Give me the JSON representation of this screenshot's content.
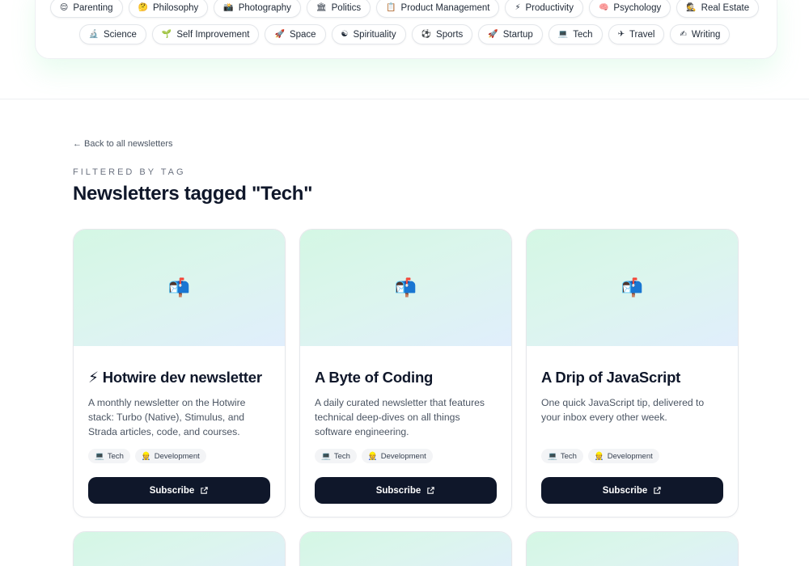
{
  "tags": {
    "row1": [
      {
        "icon": "😌",
        "label": "Parenting"
      },
      {
        "icon": "🤔",
        "label": "Philosophy"
      },
      {
        "icon": "📸",
        "label": "Photography"
      },
      {
        "icon": "🏛",
        "label": "Politics"
      },
      {
        "icon": "📋",
        "label": "Product Management"
      },
      {
        "icon": "⚡",
        "label": "Productivity"
      },
      {
        "icon": "🧠",
        "label": "Psychology"
      },
      {
        "icon": "🕵",
        "label": "Real Estate"
      }
    ],
    "row2": [
      {
        "icon": "🔬",
        "label": "Science"
      },
      {
        "icon": "🌱",
        "label": "Self Improvement"
      },
      {
        "icon": "🚀",
        "label": "Space"
      },
      {
        "icon": "☯",
        "label": "Spirituality"
      },
      {
        "icon": "⚽",
        "label": "Sports"
      },
      {
        "icon": "🚀",
        "label": "Startup"
      },
      {
        "icon": "💻",
        "label": "Tech"
      },
      {
        "icon": "✈",
        "label": "Travel"
      },
      {
        "icon": "✍",
        "label": "Writing"
      }
    ]
  },
  "back_link": "← Back to all newsletters",
  "eyebrow": "FILTERED BY TAG",
  "page_title": "Newsletters tagged \"Tech\"",
  "cards": [
    {
      "hero_icon": "📬",
      "title": "⚡ Hotwire dev newsletter",
      "description": "A monthly newsletter on the Hotwire stack: Turbo (Native), Stimulus, and Strada articles, code, and courses.",
      "tags": [
        {
          "icon": "💻",
          "label": "Tech"
        },
        {
          "icon": "👷",
          "label": "Development"
        }
      ],
      "button": "Subscribe"
    },
    {
      "hero_icon": "📬",
      "title": "A Byte of Coding",
      "description": "A daily curated newsletter that features technical deep-dives on all things software engineering.",
      "tags": [
        {
          "icon": "💻",
          "label": "Tech"
        },
        {
          "icon": "👷",
          "label": "Development"
        }
      ],
      "button": "Subscribe"
    },
    {
      "hero_icon": "📬",
      "title": "A Drip of JavaScript",
      "description": "One quick JavaScript tip, delivered to your inbox every other week.",
      "tags": [
        {
          "icon": "💻",
          "label": "Tech"
        },
        {
          "icon": "👷",
          "label": "Development"
        }
      ],
      "button": "Subscribe"
    }
  ],
  "colors": {
    "button_bg": "#0f172a",
    "hero_from": "#d4f7e4",
    "hero_to": "#e0eefc"
  }
}
